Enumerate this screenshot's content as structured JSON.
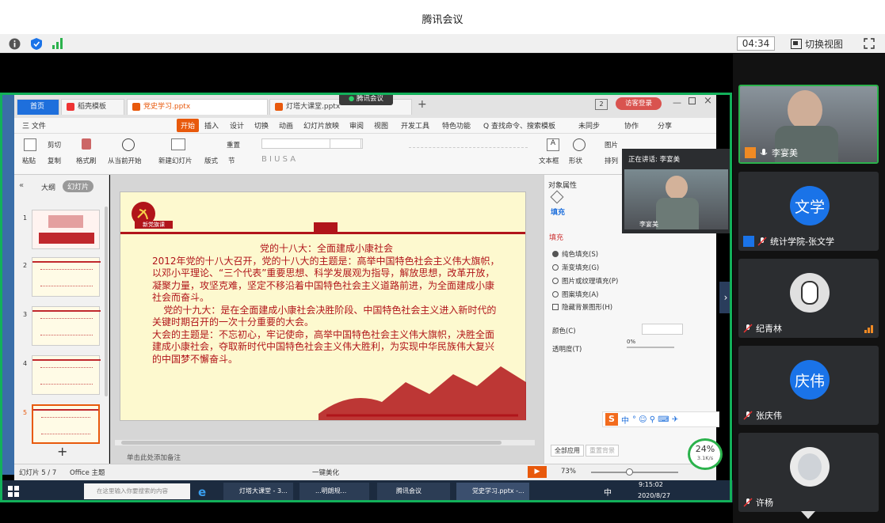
{
  "app": {
    "title": "腾讯会议",
    "timer": "04:34",
    "switch_view": "切换视图"
  },
  "wps": {
    "tabs": [
      "首页",
      "稻壳模板",
      "党史学习.pptx",
      "灯塔大课堂.pptx"
    ],
    "overlay_label": "腾讯会议",
    "login": "访客登录",
    "menu": [
      "三 文件",
      "开始",
      "插入",
      "设计",
      "切换",
      "动画",
      "幻灯片放映",
      "审阅",
      "视图",
      "开发工具",
      "特色功能",
      "Q 查找命令、搜索模板",
      "未同步",
      "协作",
      "分享"
    ],
    "ribbon": {
      "paste": "粘贴",
      "cut": "剪切",
      "copy": "复制",
      "format_painter": "格式刷",
      "play": "从当前开始",
      "new_slide": "新建幻灯片",
      "layout": "版式",
      "section": "节",
      "reset": "重置",
      "textbox": "文本框",
      "shape": "形状",
      "picture": "图片",
      "arrange": "排列",
      "fill": "填充"
    },
    "panel_tabs": [
      "大纲",
      "幻灯片"
    ],
    "slide_nums": [
      "1",
      "2",
      "3",
      "4",
      "5"
    ],
    "slide": {
      "badge": "新党旗课",
      "lines": [
        "党的十八大：全面建成小康社会",
        "2012年党的十八大召开，党的十八大的主题是：高举中国特色社会主义伟大旗帜，以邓小平理论、“三个代表”重要思想、科学发展观为指导，解放思想，改革开放，凝聚力量，攻坚克难，坚定不移沿着中国特色社会主义道路前进，为全面建成小康社会而奋斗。",
        "党的十九大：是在全面建成小康社会决胜阶段、中国特色社会主义进入新时代的关键时期召开的一次十分重要的大会。",
        "大会的主题是：不忘初心，牢记使命，高举中国特色社会主义伟大旗帜，决胜全面建成小康社会，夺取新时代中国特色社会主义伟大胜利，为实现中华民族伟大复兴的中国梦不懈奋斗。"
      ]
    },
    "props": {
      "title": "对象属性",
      "tab": "填充",
      "section": "填充",
      "options": [
        "纯色填充(S)",
        "渐变填充(G)",
        "图片或纹理填充(P)",
        "图案填充(A)",
        "隐藏背景图形(H)"
      ],
      "color_label": "颜色(C)",
      "transparency_label": "透明度(T)",
      "transparency_value": "0%",
      "apply_all": "全部应用",
      "reset_bg": "重置背景"
    },
    "notes": "单击此处添加备注",
    "status": {
      "slide_count": "幻灯片 5 / 7",
      "theme": "Office 主题",
      "beautify": "一键美化",
      "zoom": "73%"
    },
    "speaker": {
      "label": "正在讲话: 李宴美",
      "name": "李宴美"
    }
  },
  "taskbar": {
    "search": "在这里输入你要搜索的内容",
    "apps": [
      "灯塔大课堂 - 3...",
      "...明朗规...",
      "腾讯会议",
      "党史学习.pptx -..."
    ],
    "time": "9:15:02",
    "date": "2020/8/27",
    "ime": "中",
    "badge": "24%",
    "speed": "3.1K/s"
  },
  "participants": [
    {
      "name": "李宴美",
      "type": "video"
    },
    {
      "name": "统计学院-张文学",
      "type": "avatar",
      "avatar_text": "文学"
    },
    {
      "name": "纪青林",
      "type": "photo"
    },
    {
      "name": "张庆伟",
      "type": "avatar",
      "avatar_text": "庆伟"
    },
    {
      "name": "许杨",
      "type": "photo"
    }
  ]
}
